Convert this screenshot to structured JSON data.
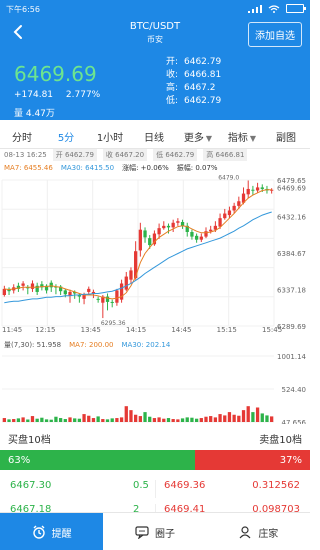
{
  "status_bar": {
    "time": "下午6:56"
  },
  "header": {
    "title": "BTC/USDT",
    "subtitle": "币安",
    "add_button": "添加自选"
  },
  "stats": {
    "last_price": "6469.69",
    "change": "+174.81",
    "change_pct": "2.777%",
    "volume": "量 4.47万",
    "open": {
      "label": "开:",
      "value": "6462.79"
    },
    "close": {
      "label": "收:",
      "value": "6466.81"
    },
    "high": {
      "label": "高:",
      "value": "6467.2"
    },
    "low": {
      "label": "低:",
      "value": "6462.79"
    }
  },
  "tabs": [
    {
      "label": "分时"
    },
    {
      "label": "5分"
    },
    {
      "label": "1小时"
    },
    {
      "label": "日线"
    },
    {
      "label": "更多"
    },
    {
      "label": "指标"
    },
    {
      "label": "副图"
    }
  ],
  "info_bar": {
    "date": "08-13 16:25",
    "open_pill": "开 6462.79",
    "close_pill": "收 6467.20",
    "low_pill": "低 6462.79",
    "high_pill": "高 6466.81"
  },
  "ma_bar": {
    "ma7": "MA7: 6455.46",
    "ma30": "MA30: 6415.50",
    "change": "涨幅: +0.06%",
    "amplitude": "振幅: 0.07%"
  },
  "price_axis": [
    "6479.65",
    "6469.69",
    "6432.16",
    "6384.67",
    "6337.18",
    "6289.69"
  ],
  "time_axis": [
    "11:45",
    "12:15",
    "13:45",
    "14:15",
    "14:45",
    "15:15",
    "15:45"
  ],
  "chart_annotations": {
    "high_label": "6479.0",
    "low_label": "6295.36"
  },
  "vol_bar": {
    "label": "量(7,30): 51.958",
    "ma7": "MA7: 200.00",
    "ma30": "MA30: 202.14"
  },
  "vol_axis": [
    "1001.14",
    "524.40",
    "47.656"
  ],
  "orderbook": {
    "buy_header": "买盘10档",
    "sell_header": "卖盘10档",
    "buy_ratio": "63%",
    "sell_ratio": "37%",
    "rows": [
      {
        "buy_price": "6467.30",
        "buy_qty": "0.5",
        "sell_price": "6469.36",
        "sell_qty": "0.312562"
      },
      {
        "buy_price": "6467.18",
        "buy_qty": "2",
        "sell_price": "6469.41",
        "sell_qty": "0.098703"
      }
    ]
  },
  "bottom_nav": [
    {
      "label": "提醒"
    },
    {
      "label": "圈子"
    },
    {
      "label": "庄家"
    }
  ],
  "colors": {
    "primary": "#1e88e5",
    "up": "#2db34a",
    "down": "#e53935",
    "ma7": "#e67e22",
    "ma30": "#3498db"
  },
  "chart_data": [
    {
      "type": "candlestick",
      "title": "",
      "x": [
        "11:45",
        "12:15",
        "13:45",
        "14:15",
        "14:45",
        "15:15",
        "15:45"
      ],
      "ylim": [
        6289.69,
        6479.65
      ],
      "series": [
        {
          "name": "candles",
          "ohlc": [
            [
              6338,
              6330,
              6342,
              6328
            ],
            [
              6335,
              6338,
              6340,
              6330
            ],
            [
              6340,
              6336,
              6344,
              6332
            ],
            [
              6338,
              6342,
              6346,
              6334
            ],
            [
              6345,
              6342,
              6348,
              6336
            ],
            [
              6339,
              6340,
              6343,
              6331
            ],
            [
              6345,
              6338,
              6349,
              6334
            ],
            [
              6334,
              6342,
              6346,
              6330
            ],
            [
              6340,
              6344,
              6348,
              6336
            ],
            [
              6336,
              6342,
              6344,
              6332
            ],
            [
              6340,
              6346,
              6349,
              6334
            ],
            [
              6340,
              6341,
              6344,
              6331
            ],
            [
              6335,
              6341,
              6343,
              6330
            ],
            [
              6331,
              6336,
              6338,
              6327
            ],
            [
              6334,
              6329,
              6337,
              6320
            ],
            [
              6332,
              6334,
              6336,
              6325
            ],
            [
              6328,
              6330,
              6332,
              6320
            ],
            [
              6330,
              6325,
              6333,
              6318
            ],
            [
              6338,
              6334,
              6341,
              6331
            ],
            [
              6334,
              6332,
              6337,
              6326
            ],
            [
              6325,
              6325,
              6328,
              6320
            ],
            [
              6328,
              6320,
              6330,
              6300
            ],
            [
              6321,
              6328,
              6332,
              6310
            ],
            [
              6320,
              6321,
              6324,
              6314
            ],
            [
              6336,
              6320,
              6338,
              6316
            ],
            [
              6345,
              6324,
              6350,
              6320
            ],
            [
              6354,
              6337,
              6360,
              6335
            ],
            [
              6362,
              6350,
              6366,
              6345
            ],
            [
              6387,
              6352,
              6400,
              6350
            ],
            [
              6415,
              6388,
              6424,
              6380
            ],
            [
              6405,
              6414,
              6418,
              6398
            ],
            [
              6395,
              6404,
              6408,
              6390
            ],
            [
              6410,
              6396,
              6414,
              6394
            ],
            [
              6417,
              6409,
              6423,
              6403
            ],
            [
              6420,
              6417,
              6426,
              6415
            ],
            [
              6418,
              6420,
              6423,
              6410
            ],
            [
              6424,
              6418,
              6428,
              6412
            ],
            [
              6426,
              6424,
              6430,
              6420
            ],
            [
              6420,
              6425,
              6428,
              6416
            ],
            [
              6412,
              6420,
              6424,
              6406
            ],
            [
              6406,
              6412,
              6415,
              6402
            ],
            [
              6402,
              6407,
              6410,
              6398
            ],
            [
              6406,
              6402,
              6410,
              6399
            ],
            [
              6413,
              6406,
              6418,
              6404
            ],
            [
              6415,
              6413,
              6420,
              6410
            ],
            [
              6420,
              6415,
              6426,
              6412
            ],
            [
              6430,
              6419,
              6436,
              6416
            ],
            [
              6436,
              6430,
              6442,
              6428
            ],
            [
              6440,
              6434,
              6445,
              6430
            ],
            [
              6446,
              6440,
              6450,
              6436
            ],
            [
              6452,
              6446,
              6458,
              6442
            ],
            [
              6462,
              6450,
              6470,
              6448
            ],
            [
              6468,
              6461,
              6479,
              6456
            ],
            [
              6466,
              6467,
              6472,
              6460
            ],
            [
              6470,
              6466,
              6476,
              6463
            ],
            [
              6468,
              6470,
              6474,
              6464
            ],
            [
              6466,
              6468,
              6472,
              6462
            ],
            [
              6467,
              6466,
              6469,
              6462
            ]
          ]
        },
        {
          "name": "MA7",
          "values": [
            6338,
            6337,
            6338,
            6339,
            6340,
            6340,
            6340,
            6340,
            6341,
            6341,
            6342,
            6341,
            6340,
            6338,
            6336,
            6334,
            6332,
            6330,
            6330,
            6330,
            6329,
            6327,
            6326,
            6325,
            6326,
            6328,
            6333,
            6342,
            6354,
            6372,
            6384,
            6392,
            6399,
            6405,
            6409,
            6413,
            6416,
            6419,
            6420,
            6419,
            6416,
            6413,
            6411,
            6411,
            6412,
            6414,
            6418,
            6424,
            6430,
            6436,
            6443,
            6450,
            6456,
            6460,
            6463,
            6466,
            6467,
            6467
          ]
        },
        {
          "name": "MA30",
          "values": [
            6320,
            6321,
            6322,
            6322,
            6323,
            6324,
            6325,
            6325,
            6326,
            6327,
            6327,
            6328,
            6328,
            6329,
            6329,
            6330,
            6330,
            6331,
            6331,
            6332,
            6332,
            6333,
            6334,
            6335,
            6337,
            6339,
            6342,
            6345,
            6349,
            6353,
            6358,
            6362,
            6366,
            6370,
            6374,
            6378,
            6381,
            6384,
            6387,
            6390,
            6392,
            6394,
            6396,
            6398,
            6400,
            6402,
            6404,
            6407,
            6410,
            6413,
            6417,
            6420,
            6424,
            6428,
            6431,
            6434,
            6436,
            6438
          ]
        }
      ]
    },
    {
      "type": "bar",
      "title": "",
      "ylim": [
        0,
        1001.14
      ],
      "values": [
        60,
        40,
        45,
        55,
        70,
        38,
        90,
        50,
        65,
        40,
        35,
        80,
        60,
        45,
        70,
        55,
        50,
        120,
        95,
        60,
        85,
        45,
        40,
        55,
        60,
        70,
        240,
        180,
        110,
        90,
        150,
        80,
        60,
        70,
        50,
        60,
        45,
        40,
        55,
        70,
        65,
        50,
        60,
        80,
        90,
        70,
        120,
        100,
        150,
        110,
        95,
        180,
        240,
        150,
        220,
        130,
        100,
        85
      ],
      "colors_up_down": "up/down"
    }
  ]
}
